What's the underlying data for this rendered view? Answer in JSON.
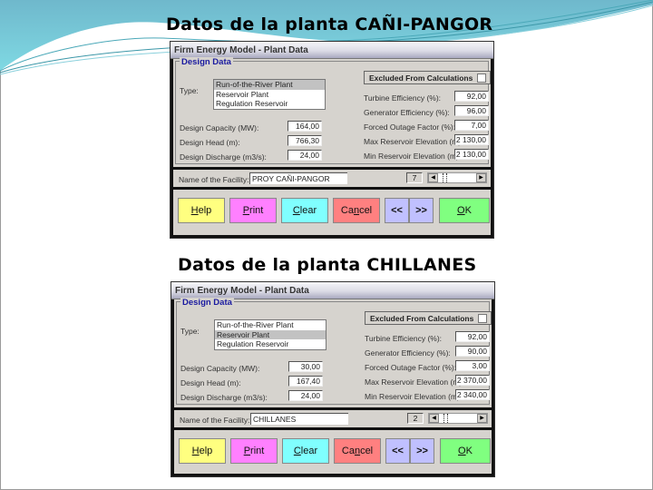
{
  "slides": [
    {
      "title": "Datos de la planta CAÑI-PANGOR",
      "dialog": {
        "window_title": "Firm Energy Model - Plant Data",
        "frame_label": "Design Data",
        "type_label": "Type:",
        "type_options": [
          "Run-of-the-River Plant",
          "Reservoir Plant",
          "Regulation Reservoir"
        ],
        "type_selected_index": 0,
        "excluded_label": "Excluded From Calculations",
        "excluded_checked": false,
        "left_fields": [
          {
            "label": "Design Capacity (MW):",
            "value": "164,00"
          },
          {
            "label": "Design Head (m):",
            "value": "766,30"
          },
          {
            "label": "Design Discharge (m3/s):",
            "value": "24,00"
          }
        ],
        "right_fields": [
          {
            "label": "Turbine Efficiency (%):",
            "value": "92,00"
          },
          {
            "label": "Generator Efficiency (%):",
            "value": "96,00"
          },
          {
            "label": "Forced Outage Factor (%):",
            "value": "7,00"
          },
          {
            "label": "Max Reservoir Elevation (m):",
            "value": "2 130,00"
          },
          {
            "label": "Min Reservoir Elevation (m):",
            "value": "2 130,00"
          }
        ],
        "name_label": "Name of the Facility:",
        "name_value": "PROY CAÑI-PANGOR",
        "record_index": "7",
        "buttons": {
          "help": {
            "mnemonic": "H",
            "rest": "elp"
          },
          "print": {
            "mnemonic": "P",
            "rest": "rint"
          },
          "clear": {
            "mnemonic": "C",
            "rest": "lear"
          },
          "cancel": {
            "pre": "Ca",
            "mnemonic": "n",
            "rest": "cel"
          },
          "prev": "<<",
          "next": ">>",
          "ok": {
            "mnemonic": "O",
            "rest": "K"
          }
        }
      }
    },
    {
      "title": "Datos de la planta CHILLANES",
      "dialog": {
        "window_title": "Firm Energy Model - Plant Data",
        "frame_label": "Design Data",
        "type_label": "Type:",
        "type_options": [
          "Run-of-the-River Plant",
          "Reservoir Plant",
          "Regulation Reservoir"
        ],
        "type_selected_index": 1,
        "excluded_label": "Excluded From Calculations",
        "excluded_checked": false,
        "left_fields": [
          {
            "label": "Design Capacity (MW):",
            "value": "30,00"
          },
          {
            "label": "Design Head (m):",
            "value": "167,40"
          },
          {
            "label": "Design Discharge (m3/s):",
            "value": "24,00"
          }
        ],
        "right_fields": [
          {
            "label": "Turbine Efficiency (%):",
            "value": "92,00"
          },
          {
            "label": "Generator Efficiency (%):",
            "value": "90,00"
          },
          {
            "label": "Forced Outage Factor (%):",
            "value": "3,00"
          },
          {
            "label": "Max Reservoir Elevation (m):",
            "value": "2 370,00"
          },
          {
            "label": "Min Reservoir Elevation (m):",
            "value": "2 340,00"
          }
        ],
        "name_label": "Name of the Facility:",
        "name_value": "CHILLANES",
        "record_index": "2",
        "buttons": {
          "help": {
            "mnemonic": "H",
            "rest": "elp"
          },
          "print": {
            "mnemonic": "P",
            "rest": "rint"
          },
          "clear": {
            "mnemonic": "C",
            "rest": "lear"
          },
          "cancel": {
            "pre": "Ca",
            "mnemonic": "n",
            "rest": "cel"
          },
          "prev": "<<",
          "next": ">>",
          "ok": {
            "mnemonic": "O",
            "rest": "K"
          }
        }
      }
    }
  ]
}
